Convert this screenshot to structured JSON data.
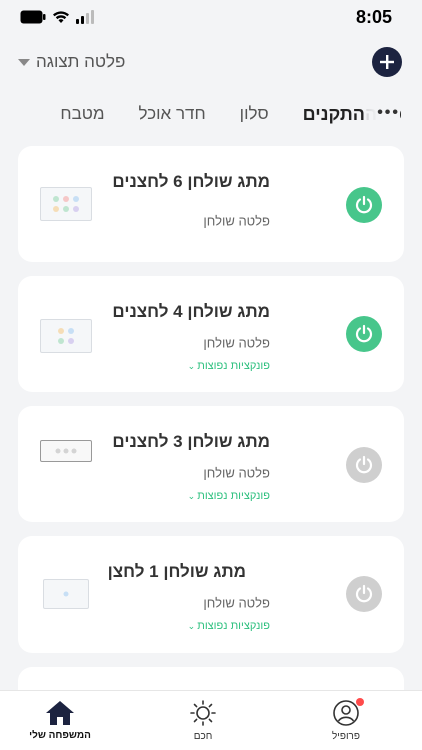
{
  "status_bar": {
    "time": "8:05",
    "icons": [
      "battery-icon",
      "wifi-icon",
      "signal-icon"
    ]
  },
  "header": {
    "panel_label": "פלטה תצוגה",
    "add_icon": "plus-icon"
  },
  "tabs": [
    {
      "label": "כל ההתקנים",
      "active": true
    },
    {
      "label": "סלון",
      "active": false
    },
    {
      "label": "חדר אוכל",
      "active": false
    },
    {
      "label": "מטבח",
      "active": false
    }
  ],
  "tabs_more": "•••",
  "devices": [
    {
      "name": "מתג שולחן  6 לחצנים",
      "room": "פלטה שולחן",
      "functions": "",
      "power": "on",
      "thumb_style": "light",
      "buttons": 6
    },
    {
      "name": "מתג שולחן 4 לחצנים",
      "room": "פלטה שולחן",
      "functions": "פונקציות נפוצות",
      "power": "on",
      "thumb_style": "light",
      "buttons": 4
    },
    {
      "name": "מתג שולחן 3 לחצנים",
      "room": "פלטה שולחן",
      "functions": "פונקציות נפוצות",
      "power": "off",
      "thumb_style": "grey",
      "buttons": 3
    },
    {
      "name": "מתג שולחן 1 לחצן",
      "room": "פלטה שולחן",
      "functions": "פונקציות נפוצות",
      "power": "off",
      "thumb_style": "grey",
      "buttons": 1
    }
  ],
  "tabbar": {
    "home": "המשפחה שלי",
    "smart": "חכם",
    "profile": "פרופיל"
  },
  "colors": {
    "accent_green": "#47c68b",
    "navy": "#1c2340",
    "power_off": "#cfcfcf",
    "badge_red": "#ff4b4b"
  }
}
